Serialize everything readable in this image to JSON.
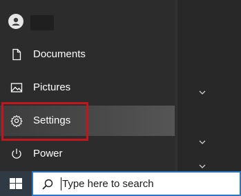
{
  "start_menu": {
    "items": [
      {
        "label": "Documents",
        "icon": "document-icon"
      },
      {
        "label": "Pictures",
        "icon": "image-icon"
      },
      {
        "label": "Settings",
        "icon": "gear-icon",
        "highlighted": true
      },
      {
        "label": "Power",
        "icon": "power-icon"
      }
    ]
  },
  "taskbar": {
    "search_placeholder": "Type here to search"
  },
  "colors": {
    "highlight_border": "#c0161c",
    "search_border": "#2a74c4"
  }
}
